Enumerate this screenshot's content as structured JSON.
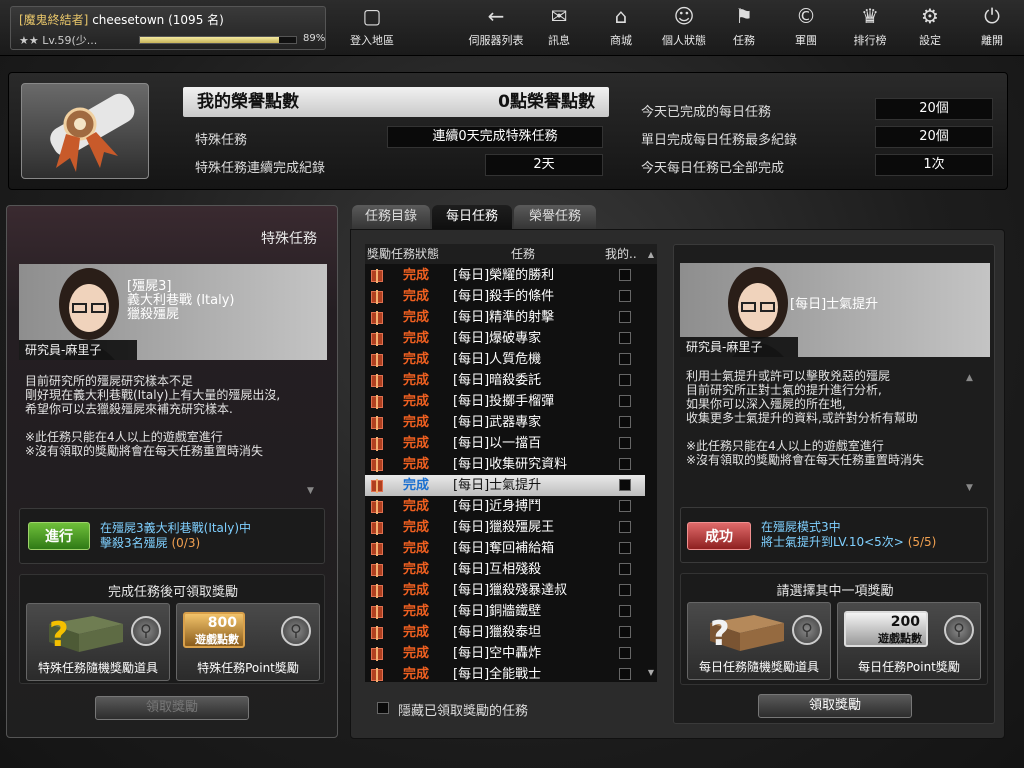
{
  "player": {
    "clan": "[魔鬼終結者]",
    "name": "cheesetown",
    "rank": "(1095 名)",
    "level": "Lv.59(少...",
    "xp_percent_label": "89%",
    "xp_fraction": 0.89
  },
  "nav": [
    {
      "id": "map",
      "label": "登入地區",
      "icon": "map-icon"
    },
    {
      "id": "server",
      "label": "伺服器列表",
      "icon": "back-arrow-icon"
    },
    {
      "id": "msg",
      "label": "訊息",
      "icon": "mail-icon"
    },
    {
      "id": "shop",
      "label": "商城",
      "icon": "shop-icon"
    },
    {
      "id": "profile",
      "label": "個人狀態",
      "icon": "profile-icon"
    },
    {
      "id": "mission",
      "label": "任務",
      "icon": "mission-icon"
    },
    {
      "id": "clan",
      "label": "軍團",
      "icon": "clan-icon"
    },
    {
      "id": "rank",
      "label": "排行榜",
      "icon": "trophy-icon"
    },
    {
      "id": "settings",
      "label": "設定",
      "icon": "gear-icon"
    },
    {
      "id": "exit",
      "label": "離開",
      "icon": "power-icon"
    }
  ],
  "honor": {
    "title": "我的榮譽點數",
    "points": "0點榮譽點數",
    "special_label": "特殊任務",
    "special_value": "連續0天完成特殊任務",
    "streak_label": "特殊任務連續完成紀錄",
    "streak_value": "2天",
    "daily_done_label": "今天已完成的每日任務",
    "daily_done_value": "20個",
    "daily_max_label": "單日完成每日任務最多紀錄",
    "daily_max_value": "20個",
    "daily_all_label": "今天每日任務已全部完成",
    "daily_all_value": "1次"
  },
  "left": {
    "section": "特殊任務",
    "mission_map": "[殭屍3]",
    "mission_name": "義大利巷戰 (Italy)",
    "mission_type": "獵殺殭屍",
    "researcher": "研究員-麻里子",
    "desc": "目前研究所的殭屍研究樣本不足\n剛好現在義大利巷戰(Italy)上有大量的殭屍出沒,\n希望你可以去獵殺殭屍來補充研究樣本.\n\n※此任務只能在4人以上的遊戲室進行\n※沒有領取的獎勵將會在每天任務重置時消失",
    "button": "進行",
    "goal_line1": "在殭屍3義大利巷戰(Italy)中",
    "goal_line2": "擊殺3名殭屍",
    "goal_count": "(0/3)",
    "reward_title": "完成任務後可領取獎勵",
    "reward1": "特殊任務隨機獎勵道具",
    "reward2": "特殊任務Point獎勵",
    "reward2_amount": "800",
    "reward2_unit": "遊戲點數",
    "claim": "領取獎勵"
  },
  "tabs": [
    "任務目錄",
    "每日任務",
    "榮譽任務"
  ],
  "list": {
    "col_status": "獎勵任務狀態",
    "col_task": "任務",
    "col_mine": "我的..",
    "status_text": "完成",
    "rows": [
      "[每日]榮耀的勝利",
      "[每日]殺手的條件",
      "[每日]精準的射擊",
      "[每日]爆破專家",
      "[每日]人質危機",
      "[每日]暗殺委託",
      "[每日]投擲手榴彈",
      "[每日]武器專家",
      "[每日]以一擋百",
      "[每日]收集研究資料",
      "[每日]士氣提升",
      "[每日]近身搏鬥",
      "[每日]獵殺殭屍王",
      "[每日]奪回補給箱",
      "[每日]互相殘殺",
      "[每日]獵殺殘暴達叔",
      "[每日]銅牆鐵壁",
      "[每日]獵殺泰坦",
      "[每日]空中轟炸",
      "[每日]全能戰士"
    ],
    "selected_index": 10,
    "hide_label": "隱藏已領取獎勵的任務"
  },
  "right": {
    "title": "[每日]士氣提升",
    "researcher": "研究員-麻里子",
    "desc": "利用士氣提升或許可以擊敗兇惡的殭屍\n目前研究所正對士氣的提升進行分析,\n如果你可以深入殭屍的所在地,\n收集更多士氣提升的資料,或許對分析有幫助\n\n※此任務只能在4人以上的遊戲室進行\n※沒有領取的獎勵將會在每天任務重置時消失",
    "button": "成功",
    "goal_line1": "在殭屍模式3中",
    "goal_line2": "將士氣提升到LV.10<5次>",
    "goal_count": "(5/5)",
    "reward_title": "請選擇其中一項獎勵",
    "reward1": "每日任務隨機獎勵道具",
    "reward2": "每日任務Point獎勵",
    "reward2_amount": "200",
    "reward2_unit": "遊戲點數",
    "claim": "領取獎勵"
  }
}
